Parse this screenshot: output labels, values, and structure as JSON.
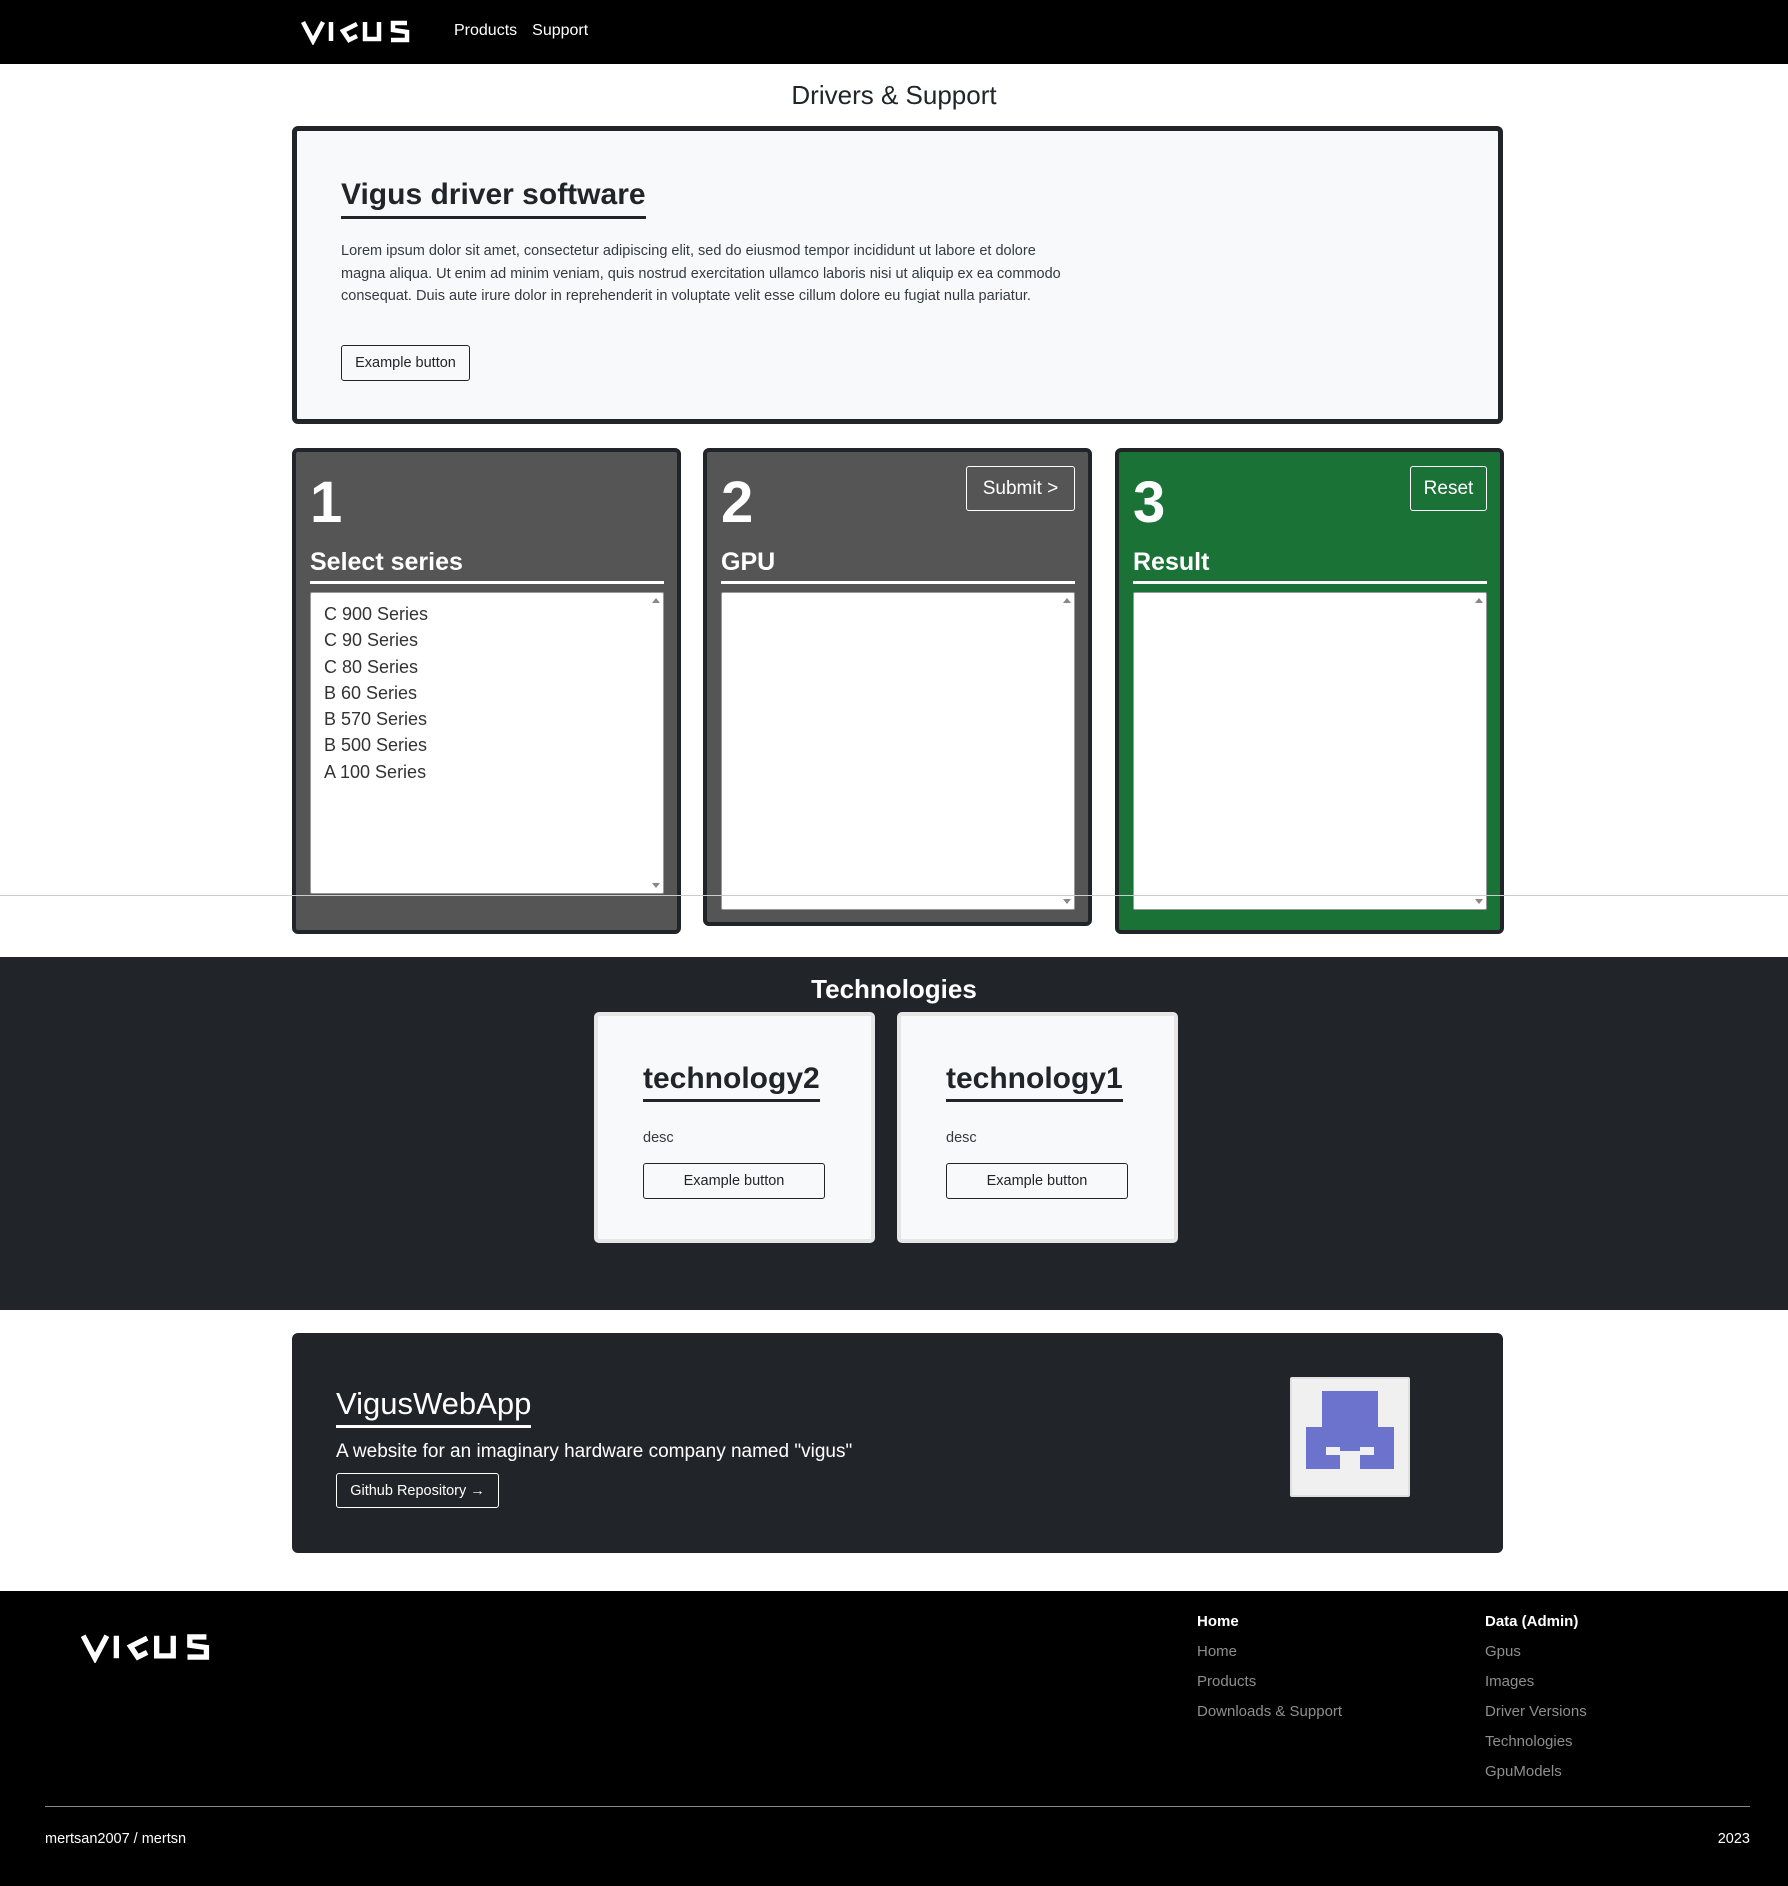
{
  "nav": {
    "brand": "VIGUS",
    "links": [
      "Products",
      "Support"
    ]
  },
  "page_title": "Drivers & Support",
  "hero": {
    "title": "Vigus driver software",
    "text": "Lorem ipsum dolor sit amet, consectetur adipiscing elit, sed do eiusmod tempor incididunt ut labore et dolore magna aliqua. Ut enim ad minim veniam, quis nostrud exercitation ullamco laboris nisi ut aliquip ex ea commodo consequat. Duis aute irure dolor in reprehenderit in voluptate velit esse cillum dolore eu fugiat nulla pariatur.",
    "button": "Example button"
  },
  "steps": [
    {
      "number": "1",
      "label": "Select series",
      "items": [
        "C 900 Series",
        "C 90 Series",
        "C 80 Series",
        "B 60 Series",
        "B 570 Series",
        "B 500 Series",
        "A 100 Series"
      ]
    },
    {
      "number": "2",
      "label": "GPU",
      "button": "Submit >",
      "items": []
    },
    {
      "number": "3",
      "label": "Result",
      "button": "Reset",
      "items": []
    }
  ],
  "technologies": {
    "title": "Technologies",
    "cards": [
      {
        "name": "technology2",
        "desc": "desc",
        "button": "Example button"
      },
      {
        "name": "technology1",
        "desc": "desc",
        "button": "Example button"
      }
    ]
  },
  "project": {
    "title": "VigusWebApp",
    "subtitle": "A website for an imaginary hardware company named \"vigus\"",
    "button": "Github Repository →"
  },
  "footer": {
    "brand": "VIGUS",
    "columns": [
      {
        "title": "Home",
        "links": [
          "Home",
          "Products",
          "Downloads & Support"
        ]
      },
      {
        "title": "Data (Admin)",
        "links": [
          "Gpus",
          "Images",
          "Driver Versions",
          "Technologies",
          "GpuModels"
        ]
      }
    ],
    "user": "mertsan2007 / mertsn",
    "year": "2023"
  },
  "colors": {
    "navbar": "#000000",
    "dark": "#212529",
    "step_gray": "#555555",
    "result_green": "#1a7236",
    "avatar_purple": "#6b73cc"
  }
}
